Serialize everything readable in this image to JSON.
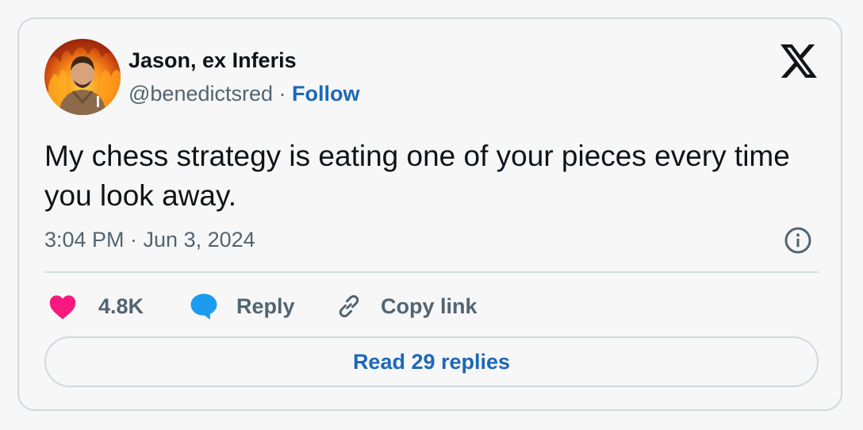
{
  "author": {
    "display_name": "Jason, ex Inferis",
    "handle": "@benedictsred",
    "separator": "·",
    "follow_label": "Follow",
    "avatar": "profile-photo-with-fire-background"
  },
  "tweet": {
    "text": "My chess strategy is eating one of your pieces every time you look away.",
    "timestamp": "3:04 PM · Jun 3, 2024"
  },
  "actions": {
    "like_count": "4.8K",
    "reply_label": "Reply",
    "copy_link_label": "Copy link"
  },
  "read_replies_label": "Read 29 replies",
  "icons": {
    "brand": "x-logo-icon",
    "info": "info-icon",
    "like": "heart-icon",
    "reply": "speech-bubble-icon",
    "copy": "link-icon"
  },
  "colors": {
    "like": "#f91880",
    "reply": "#1d9bf0",
    "link": "#1d68b8",
    "secondary_text": "#536471",
    "border": "#cfd9de"
  }
}
